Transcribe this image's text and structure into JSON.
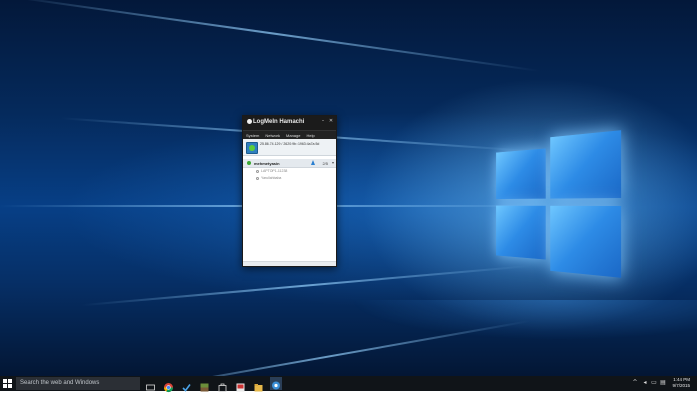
{
  "hamachi": {
    "title": "LogMeIn Hamachi",
    "menus": [
      "System",
      "Network",
      "Manage",
      "Help"
    ],
    "ip_address": "25.86.74.129 / 2620:9b::1963:4a7a:5d",
    "network": {
      "name": "mehmetyasin",
      "count": "2/5",
      "peers": [
        "LAPTOP1-11238",
        "Yarullahbaba"
      ]
    }
  },
  "taskbar": {
    "search_placeholder": "Search the web and Windows",
    "time": "1:44 PM",
    "date": "9/7/2015"
  },
  "colors": {
    "taskbar": "#101418",
    "hamachi_titlebar": "#1b1b1b",
    "online": "#3aa832",
    "accent": "#2d8be6"
  }
}
